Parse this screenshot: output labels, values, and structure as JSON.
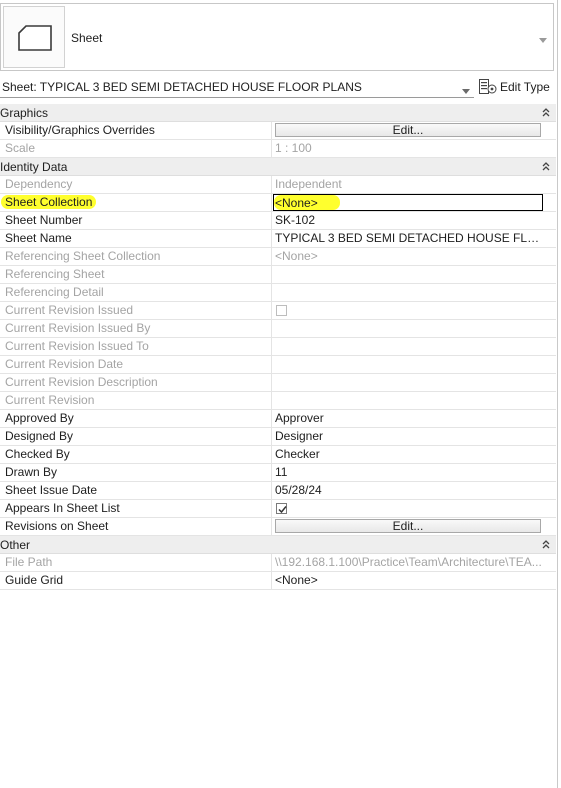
{
  "type_selector": {
    "type_name": "Sheet"
  },
  "instance": {
    "selected": "Sheet: TYPICAL 3 BED SEMI DETACHED HOUSE FLOOR PLANS",
    "edit_type_label": "Edit Type"
  },
  "groups": {
    "graphics": {
      "title": "Graphics",
      "rows": {
        "vis": {
          "name": "Visibility/Graphics Overrides",
          "value": "Edit..."
        },
        "scale": {
          "name": "Scale",
          "value": "1 : 100"
        }
      }
    },
    "identity": {
      "title": "Identity Data",
      "rows": {
        "dependency": {
          "name": "Dependency",
          "value": "Independent"
        },
        "sheet_collection": {
          "name": "Sheet Collection",
          "value": "<None>"
        },
        "sheet_number": {
          "name": "Sheet Number",
          "value": "SK-102"
        },
        "sheet_name": {
          "name": "Sheet Name",
          "value": "TYPICAL 3 BED SEMI DETACHED HOUSE FLOOR ..."
        },
        "ref_sheet_collection": {
          "name": "Referencing Sheet Collection",
          "value": "<None>"
        },
        "ref_sheet": {
          "name": "Referencing Sheet",
          "value": ""
        },
        "ref_detail": {
          "name": "Referencing Detail",
          "value": ""
        },
        "cur_rev_issued": {
          "name": "Current Revision Issued",
          "checked": false
        },
        "cur_rev_issued_by": {
          "name": "Current Revision Issued By",
          "value": ""
        },
        "cur_rev_issued_to": {
          "name": "Current Revision Issued To",
          "value": ""
        },
        "cur_rev_date": {
          "name": "Current Revision Date",
          "value": ""
        },
        "cur_rev_desc": {
          "name": "Current Revision Description",
          "value": ""
        },
        "cur_rev": {
          "name": "Current Revision",
          "value": ""
        },
        "approved_by": {
          "name": "Approved By",
          "value": "Approver"
        },
        "designed_by": {
          "name": "Designed By",
          "value": "Designer"
        },
        "checked_by": {
          "name": "Checked By",
          "value": "Checker"
        },
        "drawn_by": {
          "name": "Drawn By",
          "value": "11"
        },
        "issue_date": {
          "name": "Sheet Issue Date",
          "value": "05/28/24"
        },
        "appears_in_list": {
          "name": "Appears In Sheet List",
          "checked": true
        },
        "revisions": {
          "name": "Revisions on Sheet",
          "value": "Edit..."
        }
      }
    },
    "other": {
      "title": "Other",
      "rows": {
        "file_path": {
          "name": "File Path",
          "value": "\\\\192.168.1.100\\Practice\\Team\\Architecture\\TEA..."
        },
        "guide_grid": {
          "name": "Guide Grid",
          "value": "<None>"
        }
      }
    }
  },
  "colors": {
    "highlight": "#ffff2e",
    "disabled_text": "#a4a4a4",
    "group_bg": "#eeeeee"
  }
}
